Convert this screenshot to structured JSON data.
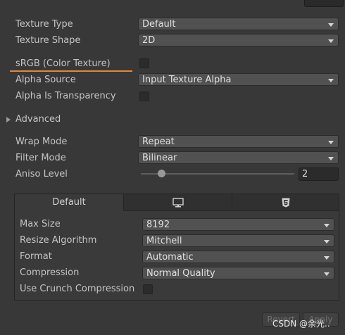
{
  "texture": {
    "type": {
      "label": "Texture Type",
      "value": "Default"
    },
    "shape": {
      "label": "Texture Shape",
      "value": "2D"
    },
    "srgb": {
      "label": "sRGB (Color Texture)",
      "checked": false
    },
    "alpha_source": {
      "label": "Alpha Source",
      "value": "Input Texture Alpha"
    },
    "alpha_transparency": {
      "label": "Alpha Is Transparency",
      "checked": false
    },
    "advanced": {
      "label": "Advanced",
      "expanded": false
    },
    "wrap_mode": {
      "label": "Wrap Mode",
      "value": "Repeat"
    },
    "filter_mode": {
      "label": "Filter Mode",
      "value": "Bilinear"
    },
    "aniso": {
      "label": "Aniso Level",
      "value": "2",
      "slider_fraction": 0.12
    }
  },
  "platform": {
    "tabs": [
      {
        "label": "Default",
        "icon": null
      },
      {
        "label": "",
        "icon": "monitor-icon"
      },
      {
        "label": "",
        "icon": "html5-icon"
      }
    ],
    "max_size": {
      "label": "Max Size",
      "value": "8192"
    },
    "resize_algorithm": {
      "label": "Resize Algorithm",
      "value": "Mitchell"
    },
    "format": {
      "label": "Format",
      "value": "Automatic"
    },
    "compression": {
      "label": "Compression",
      "value": "Normal Quality"
    },
    "crunch": {
      "label": "Use Crunch Compression",
      "checked": false
    }
  },
  "footer": {
    "revert": "Revert",
    "apply": "Apply"
  },
  "watermark": "CSDN @余光.."
}
